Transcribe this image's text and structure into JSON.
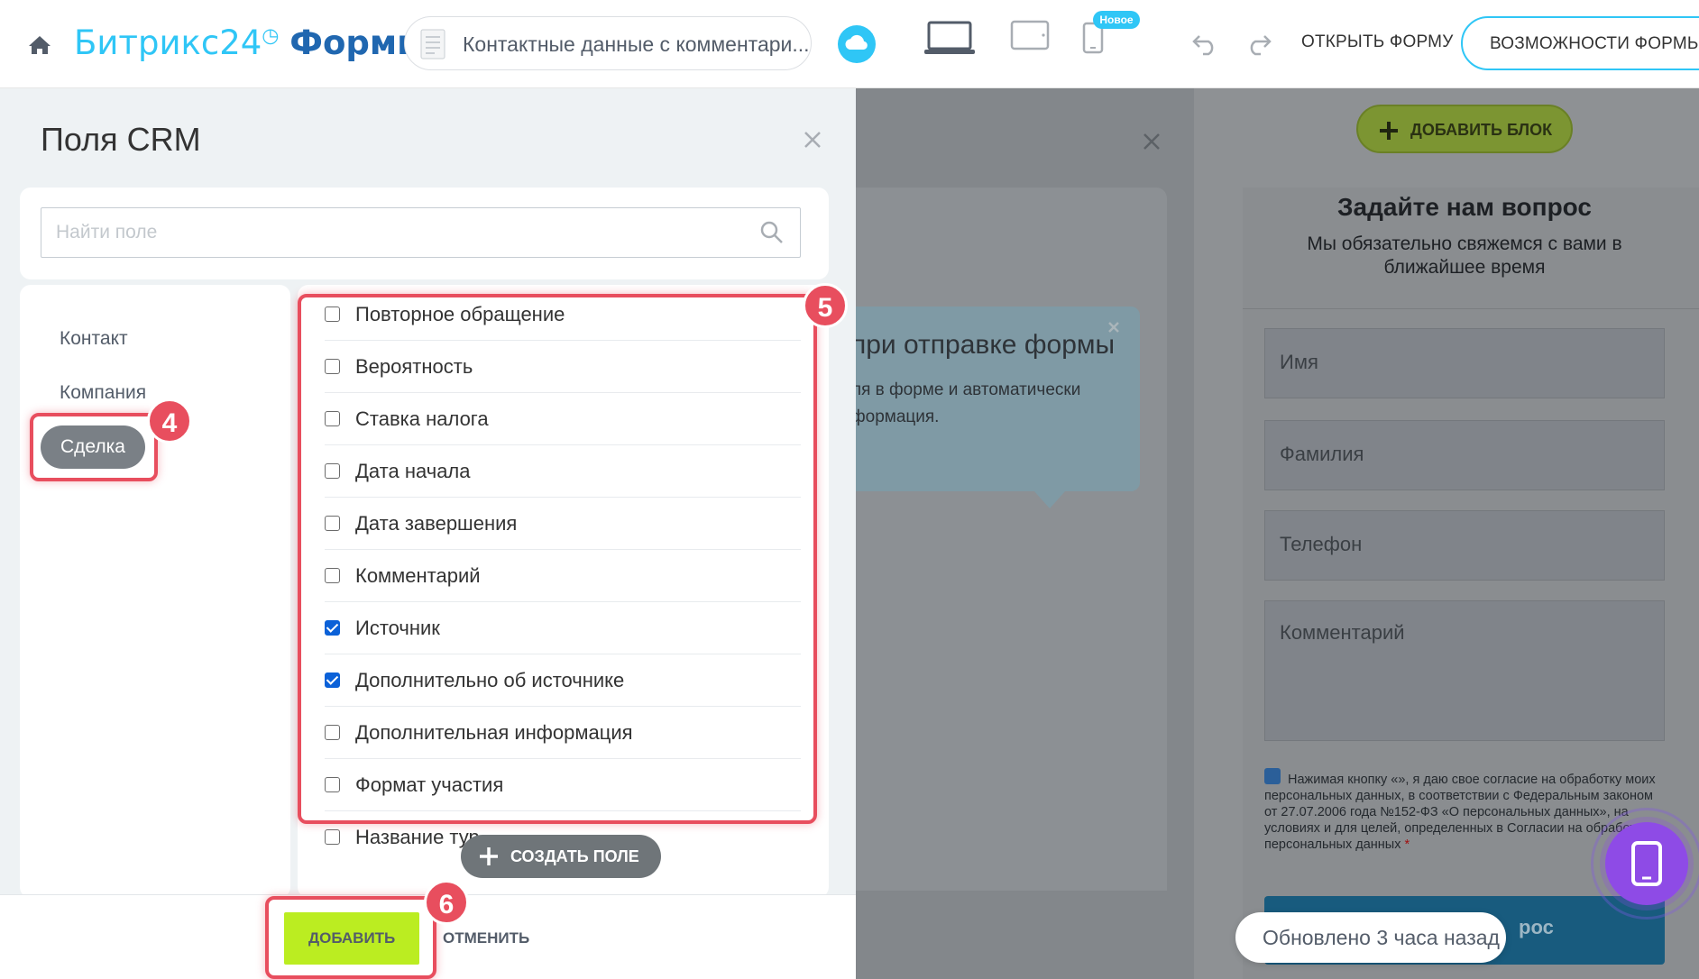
{
  "header": {
    "brand_part1": "Битрикс24",
    "brand_clock": "◷",
    "brand_part2": "Формы",
    "document_title": "Контактные данные с комментари...",
    "new_badge": "Новое",
    "open_form": "ОТКРЫТЬ ФОРМУ",
    "features": "ВОЗМОЖНОСТИ ФОРМЫ"
  },
  "crm_panel": {
    "title": "Поля CRM",
    "search_placeholder": "Найти поле",
    "entities": [
      {
        "label": "Контакт",
        "selected": false
      },
      {
        "label": "Компания",
        "selected": false
      },
      {
        "label": "Сделка",
        "selected": true
      }
    ],
    "fields": [
      {
        "label": "Повторное обращение",
        "checked": false
      },
      {
        "label": "Вероятность",
        "checked": false
      },
      {
        "label": "Ставка налога",
        "checked": false
      },
      {
        "label": "Дата начала",
        "checked": false
      },
      {
        "label": "Дата завершения",
        "checked": false
      },
      {
        "label": "Комментарий",
        "checked": false
      },
      {
        "label": "Источник",
        "checked": true
      },
      {
        "label": "Дополнительно об источнике",
        "checked": true
      },
      {
        "label": "Дополнительная информация",
        "checked": false
      },
      {
        "label": "Формат участия",
        "checked": false
      },
      {
        "label": "Название тур",
        "checked": false
      }
    ],
    "create_field": "СОЗДАТЬ ПОЛЕ",
    "add_button": "ДОБАВИТЬ",
    "cancel_button": "ОТМЕНИТЬ"
  },
  "tooltip": {
    "title": "при отправке формы",
    "text": "ля в форме и автоматически формация."
  },
  "preview": {
    "add_block": "ДОБАВИТЬ БЛОК",
    "title": "Задайте нам вопрос",
    "subtitle": "Мы обязательно свяжемся с вами в ближайшее время",
    "fields": [
      "Имя",
      "Фамилия",
      "Телефон",
      "Комментарий"
    ],
    "consent": "Нажимая кнопку «», я даю свое согласие на обработку моих персональных данных, в соответствии с Федеральным законом от 27.07.2006 года №152-ФЗ «О персональных данных», на условиях и для целей, определенных в Согласии на обработку персональных данных",
    "consent_required": "*",
    "submit_partial": "рос",
    "updated": "Обновлено 3 часа назад"
  },
  "annotations": [
    "4",
    "5",
    "6"
  ],
  "colors": {
    "accent": "#2fc6f6",
    "brand_dark": "#2067b0",
    "add_green": "#bbed21",
    "highlight_red": "#e84e5e",
    "checkbox_blue": "#0b61d8",
    "mobile_purple": "#8e4be6"
  }
}
